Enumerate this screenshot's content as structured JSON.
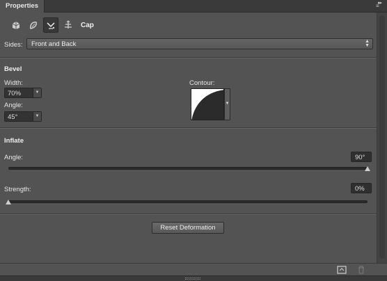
{
  "tab": {
    "title": "Properties"
  },
  "toolbar": {
    "tools": [
      {
        "name": "mesh",
        "icon": "mesh-icon"
      },
      {
        "name": "deform",
        "icon": "deform-icon"
      },
      {
        "name": "cap",
        "icon": "cap-icon",
        "active": true
      },
      {
        "name": "coordinates",
        "icon": "coordinates-icon"
      }
    ],
    "active_label": "Cap"
  },
  "sides": {
    "label": "Sides:",
    "value": "Front and Back"
  },
  "bevel": {
    "title": "Bevel",
    "width_label": "Width:",
    "width_value": "70%",
    "angle_label": "Angle:",
    "angle_value": "45°",
    "contour_label": "Contour:"
  },
  "inflate": {
    "title": "Inflate",
    "angle_label": "Angle:",
    "angle_value": "90°",
    "angle_slider_fraction": 1.0,
    "strength_label": "Strength:",
    "strength_value": "0%",
    "strength_slider_fraction": 0.0
  },
  "actions": {
    "reset_label": "Reset Deformation"
  },
  "colors": {
    "panel_bg": "#535353",
    "tab_bar_bg": "#3a3a3a",
    "field_bg": "#333333"
  }
}
